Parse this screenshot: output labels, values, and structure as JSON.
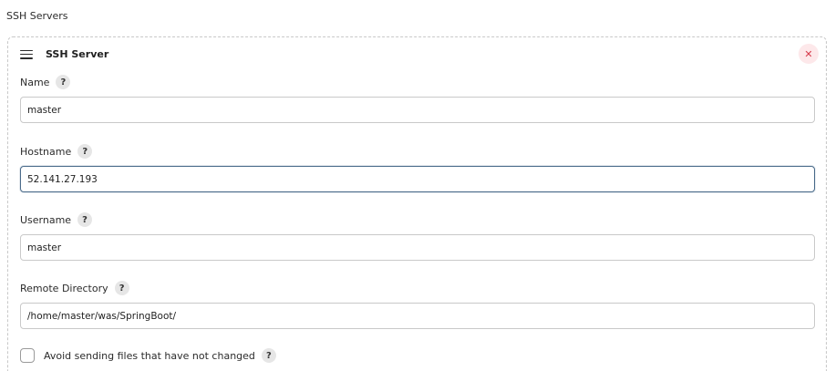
{
  "section": {
    "title": "SSH Servers"
  },
  "server": {
    "title": "SSH Server",
    "delete_label": "✕",
    "fields": {
      "name": {
        "label": "Name",
        "value": "master"
      },
      "hostname": {
        "label": "Hostname",
        "value": "52.141.27.193"
      },
      "username": {
        "label": "Username",
        "value": "master"
      },
      "remote_directory": {
        "label": "Remote Directory",
        "value": "/home/master/was/SpringBoot/"
      }
    },
    "help_label": "?",
    "avoid_sending": {
      "label": "Avoid sending files that have not changed",
      "checked": false
    }
  },
  "colors": {
    "focus_border": "#4a6b8a",
    "delete_bg": "#fde8ea",
    "delete_fg": "#d63a4b"
  }
}
